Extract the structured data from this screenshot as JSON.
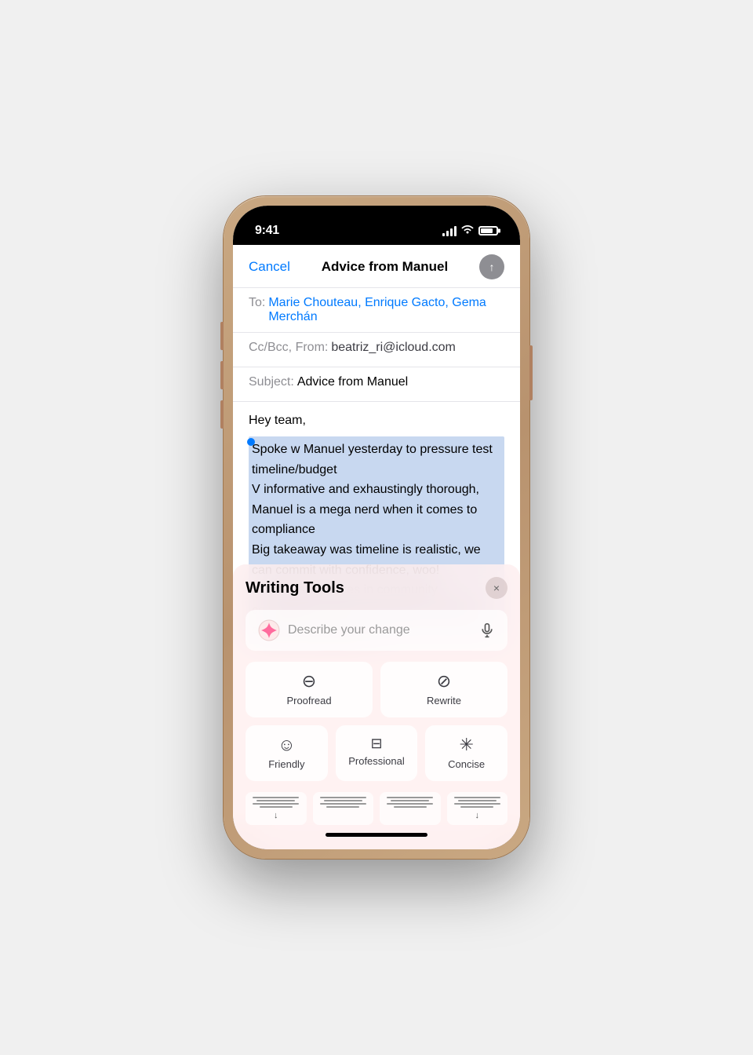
{
  "status_bar": {
    "time": "9:41",
    "signal_label": "signal",
    "wifi_label": "wifi",
    "battery_label": "battery"
  },
  "mail": {
    "cancel_label": "Cancel",
    "title": "Advice from Manuel",
    "send_label": "↑",
    "to_label": "To:",
    "to_recipients": "Marie Chouteau, Enrique Gacto, Gema Merchán",
    "ccbcc_label": "Cc/Bcc, From:",
    "from_email": "beatriz_ri@icloud.com",
    "subject_label": "Subject:",
    "subject_value": "Advice from Manuel",
    "body_greeting": "Hey team,",
    "body_selected": "Spoke w Manuel yesterday to pressure test timeline/budget\nV informative and exhaustingly thorough, Manuel is a mega nerd when it comes to compliance\nBig takeaway was timeline is realistic, we can commit with confidence, woo!\nM's firm specializes in community consultation, we need help here, should consider engaging th..."
  },
  "writing_tools": {
    "title": "Writing Tools",
    "close_label": "×",
    "describe_placeholder": "Describe your change",
    "tools": [
      {
        "id": "proofread",
        "icon": "⊖",
        "label": "Proofread"
      },
      {
        "id": "rewrite",
        "icon": "⊘",
        "label": "Rewrite"
      },
      {
        "id": "friendly",
        "icon": "☺",
        "label": "Friendly"
      },
      {
        "id": "professional",
        "icon": "⊟",
        "label": "Professional"
      },
      {
        "id": "concise",
        "icon": "✳",
        "label": "Concise"
      }
    ],
    "keyboard_chips": [
      {
        "id": "chip1",
        "arrow": "↓"
      },
      {
        "id": "chip2",
        "arrow": ""
      },
      {
        "id": "chip3",
        "arrow": ""
      },
      {
        "id": "chip4",
        "arrow": "↓"
      }
    ]
  }
}
